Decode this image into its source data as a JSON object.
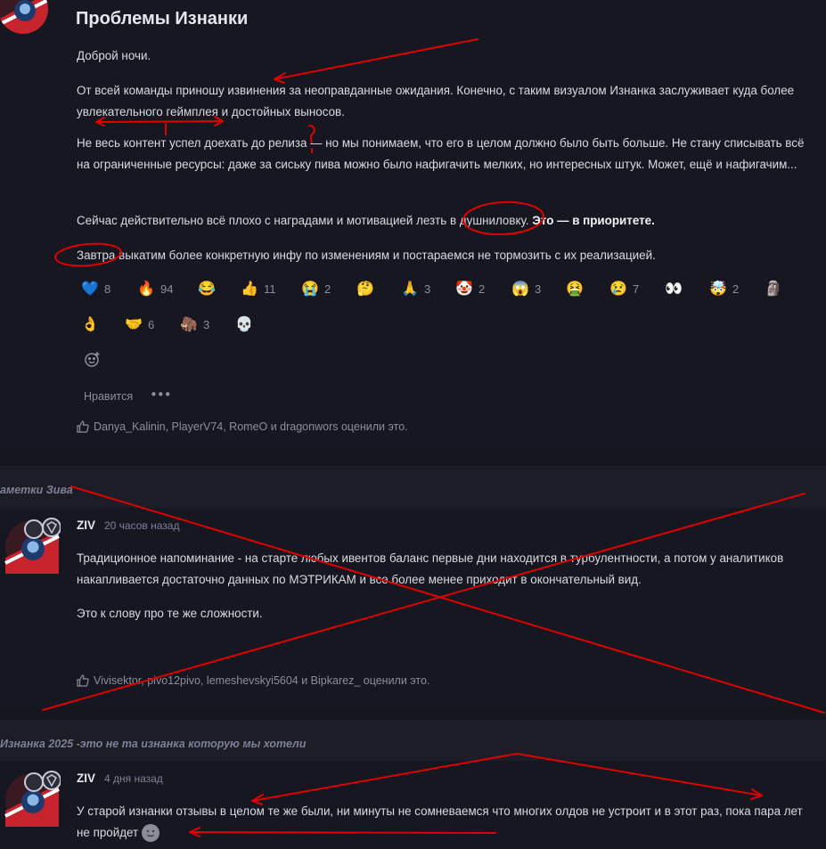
{
  "post1": {
    "title": "Проблемы Изнанки",
    "paragraphs": {
      "p1": "Доброй ночи.",
      "p2": "От всей команды приношу извинения за неоправданные ожидания. Конечно, с таким визуалом Изнанка заслуживает куда более увлекательного геймплея и достойных выносов.",
      "p3": "Не весь контент успел доехать до релиза — но мы понимаем, что его в целом должно было быть больше. Не стану списывать всё на ограниченные ресурсы: даже за сиську пива можно было нафигачить мелких, но интересных штук. Может, ещё и нафигачим...",
      "p4_text": "Сейчас действительно всё плохо с наградами и мотивацией лезть в душниловку. ",
      "p4_bold": "Это — в приоритете.",
      "p5": "Завтра выкатим более конкретную инфу по изменениям и постараемся не тормозить с их реализацией."
    },
    "reactions": [
      {
        "emoji": "💙",
        "count": "8"
      },
      {
        "emoji": "🔥",
        "count": "94"
      },
      {
        "emoji": "😂",
        "count": ""
      },
      {
        "emoji": "👍",
        "count": "11"
      },
      {
        "emoji": "😭",
        "count": "2"
      },
      {
        "emoji": "🤔",
        "count": ""
      },
      {
        "emoji": "🙏",
        "count": "3"
      },
      {
        "emoji": "🤡",
        "count": "2"
      },
      {
        "emoji": "😱",
        "count": "3"
      },
      {
        "emoji": "🤮",
        "count": ""
      },
      {
        "emoji": "😢",
        "count": "7"
      },
      {
        "emoji": "👀",
        "count": ""
      },
      {
        "emoji": "🤯",
        "count": "2"
      },
      {
        "emoji": "🗿",
        "count": ""
      },
      {
        "emoji": "👌",
        "count": ""
      },
      {
        "emoji": "🤝",
        "count": "6"
      },
      {
        "emoji": "🦣",
        "count": "3"
      },
      {
        "emoji": "💀",
        "count": ""
      }
    ],
    "like_label": "Нравится",
    "more_label": "•••",
    "likers": "Danya_Kalinin, PlayerV74, RomeO и dragonwors оценили это."
  },
  "post2": {
    "section_title": "аметки Зива",
    "author": "ZIV",
    "time": "20 часов назад",
    "p1": "Традиционное напоминание - на старте любых ивентов баланс первые дни находится в турбулентности, а потом у аналитиков накапливается достаточно данных по МЭТРИКАМ и все более менее приходит в окончательный вид.",
    "p2": "Это к слову про те же сложности.",
    "likers": "Vivisektor, pivo12pivo, lemeshevskyi5604 и Bipkarez_ оценили это."
  },
  "post3": {
    "section_title": "Изнанка 2025 -это не та изнанка которую мы хотели",
    "author": "ZIV",
    "time": "4 дня назад",
    "p1": "У старой изнанки отзывы в целом те же были, ни минуты не сомневаемся что многих олдов не устроит и в этот раз, пока пара лет не пройдет"
  },
  "colors": {
    "background": "#161720",
    "section_band": "#1c1d27",
    "muted_text": "#8b8e9c",
    "annotation_red": "#e00000"
  }
}
